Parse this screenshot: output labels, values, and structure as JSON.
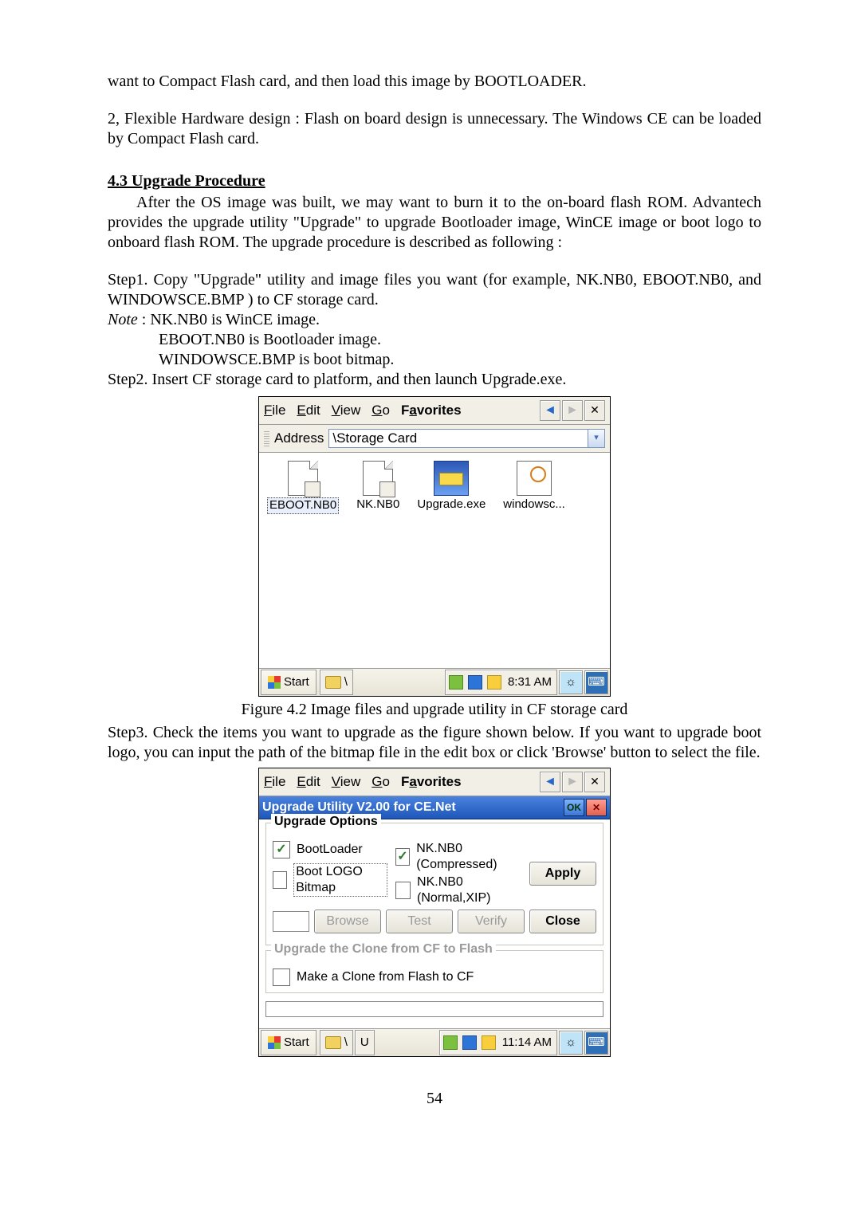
{
  "para_want": "want to Compact Flash card, and then load this image by BOOTLOADER.",
  "para_flex": "2, Flexible Hardware design : Flash on board design is unnecessary. The Windows CE can be loaded by Compact Flash card.",
  "heading43": "4.3 Upgrade Procedure",
  "para_afteros": "After the OS image was built, we may want to burn it to the on-board flash ROM. Advantech provides the upgrade utility \"Upgrade\" to upgrade Bootloader image, WinCE image or boot logo to onboard flash ROM. The upgrade procedure is described as following :",
  "step1a": "Step1. Copy \"Upgrade\" utility and image files you want (for example, NK.NB0, EBOOT.NB0, and WINDOWSCE.BMP ) to CF storage card.",
  "note_lead_it": "Note",
  "note_lead_rest": " : NK.NB0 is WinCE image.",
  "note2": "EBOOT.NB0 is Bootloader image.",
  "note3": "WINDOWSCE.BMP is boot bitmap.",
  "step2": "Step2. Insert CF storage card to platform, and then launch Upgrade.exe.",
  "menu": {
    "file_u": "F",
    "file_r": "ile",
    "edit_u": "E",
    "edit_r": "dit",
    "view_u": "V",
    "view_r": "iew",
    "go_u": "G",
    "go_r": "o",
    "fav_l": "F",
    "fav_u": "a",
    "fav_r": "vorites",
    "close": "✕"
  },
  "addr_label": "Address",
  "addr_value": "\\Storage Card",
  "files": {
    "eboot": "EBOOT.NB0",
    "nk": "NK.NB0",
    "upg": "Upgrade.exe",
    "bmp": "windowsc..."
  },
  "tb_start": "Start",
  "tb_time1": "8:31 AM",
  "caption1": "Figure 4.2 Image files and upgrade utility in CF storage card",
  "step3": "Step3. Check the items you want to upgrade as the figure shown below. If you want to upgrade boot logo, you can input the path of the bitmap file in the edit box or click 'Browse' button to select the file.",
  "dlg_title": "Upgrade Utility V2.00 for CE.Net",
  "dlg_ok": "OK",
  "grp_options": "Upgrade Options",
  "chk_boot": "BootLoader",
  "opt_comp": "NK.NB0 (Compressed)",
  "opt_norm": "NK.NB0 (Normal,XIP)",
  "chk_logo": "Boot LOGO Bitmap",
  "btn_apply": "Apply",
  "btn_browse": "Browse",
  "btn_test": "Test",
  "btn_verify": "Verify",
  "btn_close": "Close",
  "grp_clone_line": "Upgrade the Clone from CF to Flash",
  "chk_clone": "Make a Clone from Flash to CF",
  "tb_time2": "11:14 AM",
  "tb_taskapp": "U",
  "pagenum": "54"
}
